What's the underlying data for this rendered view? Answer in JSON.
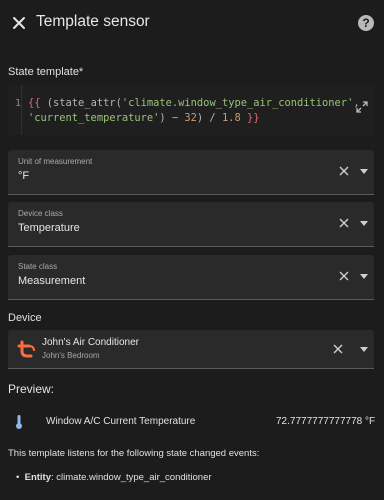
{
  "dialog": {
    "title": "Template sensor"
  },
  "state_template": {
    "label": "State template*",
    "line_number": "1",
    "code": {
      "brace_open": "{{",
      "paren_open": " (",
      "func": "state_attr",
      "arg_open": "(",
      "entity": "'climate.window_type_air_conditioner'",
      "comma": ",",
      "attribute": "'current_temperature'",
      "minus": ") − ",
      "num1": "32",
      "divide": ") / ",
      "num2": "1.8",
      "brace_close": " }}"
    }
  },
  "fields": {
    "unit": {
      "label": "Unit of measurement",
      "value": "°F"
    },
    "device_class": {
      "label": "Device class",
      "value": "Temperature"
    },
    "state_class": {
      "label": "State class",
      "value": "Measurement"
    }
  },
  "device": {
    "label": "Device",
    "name": "John's Air Conditioner",
    "area": "John's Bedroom",
    "accent_color": "#ff6c40"
  },
  "preview": {
    "label": "Preview:",
    "entity_name": "Window A/C Current Temperature",
    "value": "72.7777777777778 °F",
    "listen_text": "This template listens for the following state changed events:",
    "entity_label": "Entity",
    "entity_id": ": climate.window_type_air_conditioner"
  },
  "icons": {
    "close": "close-icon",
    "help": "help-icon",
    "expand": "expand-icon",
    "clear": "clear-icon",
    "dropdown": "chevron-down-icon",
    "thermometer": "thermometer-icon",
    "device_brand": "tuya-icon"
  }
}
